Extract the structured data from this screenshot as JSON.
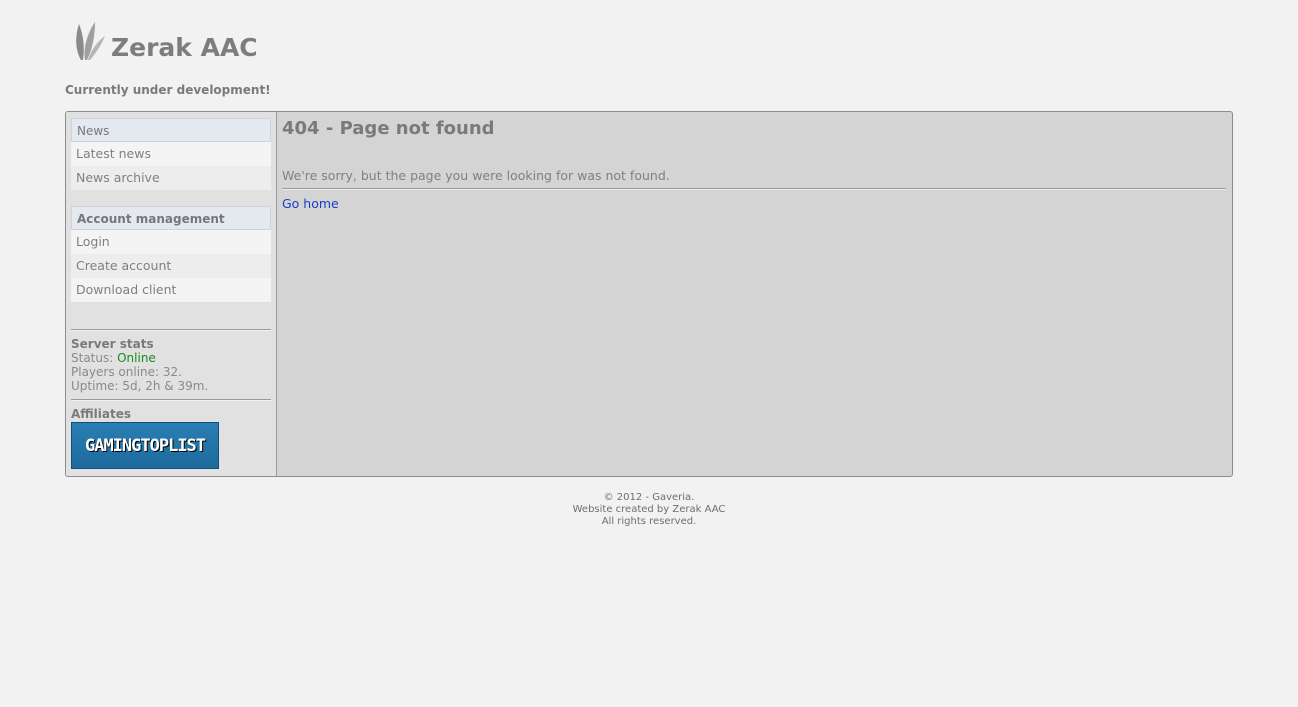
{
  "site": {
    "title": "Zerak AAC",
    "tagline": "Currently under development!",
    "logo_icon": "leaf-icon"
  },
  "sidebar": {
    "sections": [
      {
        "header": "News",
        "items": [
          {
            "label": "Latest news"
          },
          {
            "label": "News archive"
          }
        ]
      },
      {
        "header": "Account management",
        "items": [
          {
            "label": "Login"
          },
          {
            "label": "Create account"
          },
          {
            "label": "Download client"
          }
        ]
      }
    ],
    "server_stats": {
      "title": "Server stats",
      "status_label": "Status:",
      "status_value": "Online",
      "players_online": "Players online: 32.",
      "uptime": "Uptime: 5d, 2h & 39m."
    },
    "affiliates": {
      "title": "Affiliates",
      "badge_text": "GAMINGTOPLIST"
    }
  },
  "content": {
    "title": "404 - Page not found",
    "message": "We're sorry, but the page you were looking for was not found.",
    "link_label": "Go home"
  },
  "footer": {
    "line1": "© 2012 - Gaveria.",
    "line2": "Website created by Zerak AAC",
    "line3": "All rights reserved."
  },
  "colors": {
    "page_bg": "#f2f2f2",
    "box_bg": "#d4d4d4",
    "sidebar_bg": "#e1e1e1",
    "online": "#1a8a1a",
    "link": "#1a3fc4"
  }
}
